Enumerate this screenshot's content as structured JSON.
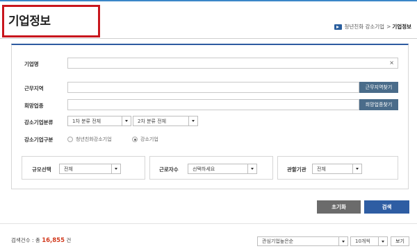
{
  "header": {
    "title": "기업정보",
    "breadcrumb": [
      "청년친화 강소기업",
      "기업정보"
    ],
    "breadcrumb_sep": ">"
  },
  "form": {
    "company_name": {
      "label": "기업명",
      "value": "",
      "clear_icon": "×"
    },
    "work_region": {
      "label": "근무지역",
      "value": "",
      "button": "근무지역찾기"
    },
    "job_type": {
      "label": "희망업종",
      "value": "",
      "button": "희망업종찾기"
    },
    "category": {
      "label": "강소기업분류",
      "first": "1차 분류 전체",
      "second": "2차 분류 전체"
    },
    "type": {
      "label": "강소기업구분",
      "options": [
        {
          "label": "청년친화강소기업",
          "checked": false
        },
        {
          "label": "강소기업",
          "checked": true
        }
      ]
    },
    "filters": {
      "size": {
        "label": "규모선택",
        "value": "전체"
      },
      "employees": {
        "label": "근로자수",
        "value": "선택하세요"
      },
      "agency": {
        "label": "관할기관",
        "value": "전체"
      }
    }
  },
  "actions": {
    "reset": "초기화",
    "search": "검색"
  },
  "results": {
    "count_prefix": "검색건수 : 총",
    "count": "16,855",
    "count_suffix": "건",
    "sort": "관심기업높은순",
    "per_page": "10개씩",
    "view_button": "보기"
  },
  "colors": {
    "accent": "#2c5aa0",
    "highlight_box": "#c8161d",
    "side_button": "#4a6c8a",
    "reset_button": "#6b6b6b",
    "search_button": "#2e5da3",
    "count": "#d23b1f"
  }
}
